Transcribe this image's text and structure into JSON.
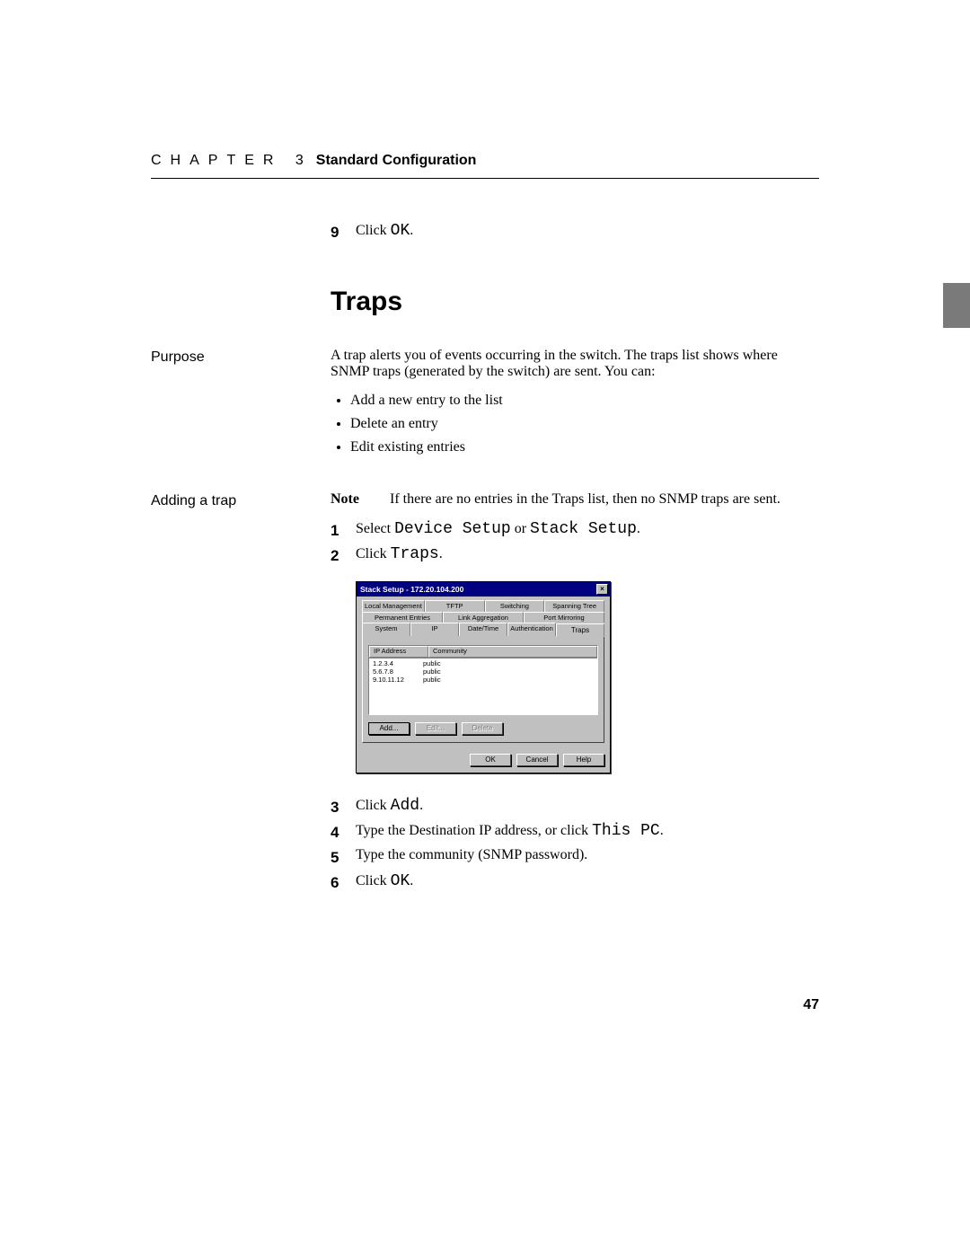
{
  "header": {
    "chapter_label": "CHAPTER 3",
    "chapter_title": "Standard Configuration"
  },
  "step9": {
    "num": "9",
    "pre": "Click ",
    "code": "OK",
    "post": "."
  },
  "section_title": "Traps",
  "purpose": {
    "label": "Purpose",
    "text": "A trap alerts you of events occurring in the switch. The traps list shows where SNMP traps (generated by the switch) are sent. You can:",
    "bullets": [
      "Add a new entry to the list",
      "Delete an entry",
      "Edit existing entries"
    ]
  },
  "adding": {
    "label": "Adding a trap",
    "note_label": "Note",
    "note_text": "If there are no entries in the Traps list, then no SNMP traps are sent.",
    "steps_top": [
      {
        "num": "1",
        "parts": [
          "Select ",
          "Device Setup",
          " or ",
          "Stack Setup",
          "."
        ]
      },
      {
        "num": "2",
        "parts": [
          "Click ",
          "Traps",
          "."
        ]
      }
    ],
    "steps_bottom": [
      {
        "num": "3",
        "parts": [
          "Click ",
          "Add",
          "."
        ]
      },
      {
        "num": "4",
        "parts": [
          "Type the Destination IP address, or click ",
          "This PC",
          "."
        ]
      },
      {
        "num": "5",
        "parts": [
          "Type the community (SNMP password)."
        ]
      },
      {
        "num": "6",
        "parts": [
          "Click ",
          "OK",
          "."
        ]
      }
    ]
  },
  "dialog": {
    "title": "Stack Setup - 172.20.104.200",
    "close": "×",
    "tabs_row1": [
      "Local Management",
      "TFTP",
      "Switching",
      "Spanning Tree"
    ],
    "tabs_row2": [
      "Permanent Entries",
      "Link Aggregation",
      "Port Mirroring"
    ],
    "tabs_row3": [
      "System",
      "IP",
      "Date/Time",
      "Authentication",
      "Traps"
    ],
    "active_tab": "Traps",
    "columns": [
      "IP Address",
      "Community"
    ],
    "rows": [
      {
        "ip": "1.2.3.4",
        "community": "public"
      },
      {
        "ip": "5.6.7.8",
        "community": "public"
      },
      {
        "ip": "9.10.11.12",
        "community": "public"
      }
    ],
    "list_buttons": {
      "add": "Add...",
      "edit": "Edit...",
      "delete": "Delete"
    },
    "footer_buttons": {
      "ok": "OK",
      "cancel": "Cancel",
      "help": "Help"
    }
  },
  "page_number": "47"
}
